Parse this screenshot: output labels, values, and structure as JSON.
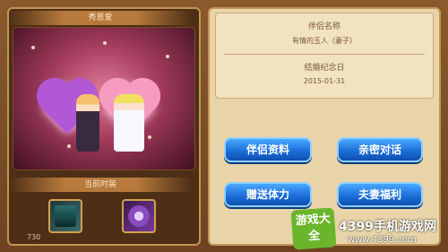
{
  "left_panel": {
    "title": "秀恩爱",
    "outfit_title": "当前时装",
    "number": "730"
  },
  "right_panel": {
    "partner_label": "伴侣名称",
    "partner_value": "有情的玉人（妻子）",
    "anniversary_label": "结婚纪念日",
    "anniversary_value": "2015-01-31"
  },
  "buttons": {
    "partner_info": "伴侣资料",
    "private_chat": "亲密对话",
    "give_stamina": "赠送体力",
    "couple_benefit": "夫妻福利"
  },
  "watermark": {
    "logo": "游戏大全",
    "brand": "4399手机游戏网",
    "url": "www.4399.com"
  },
  "colors": {
    "button_blue": "#1c6fd9",
    "panel_bg": "#e8d4a8",
    "frame_brown": "#6d4320"
  }
}
